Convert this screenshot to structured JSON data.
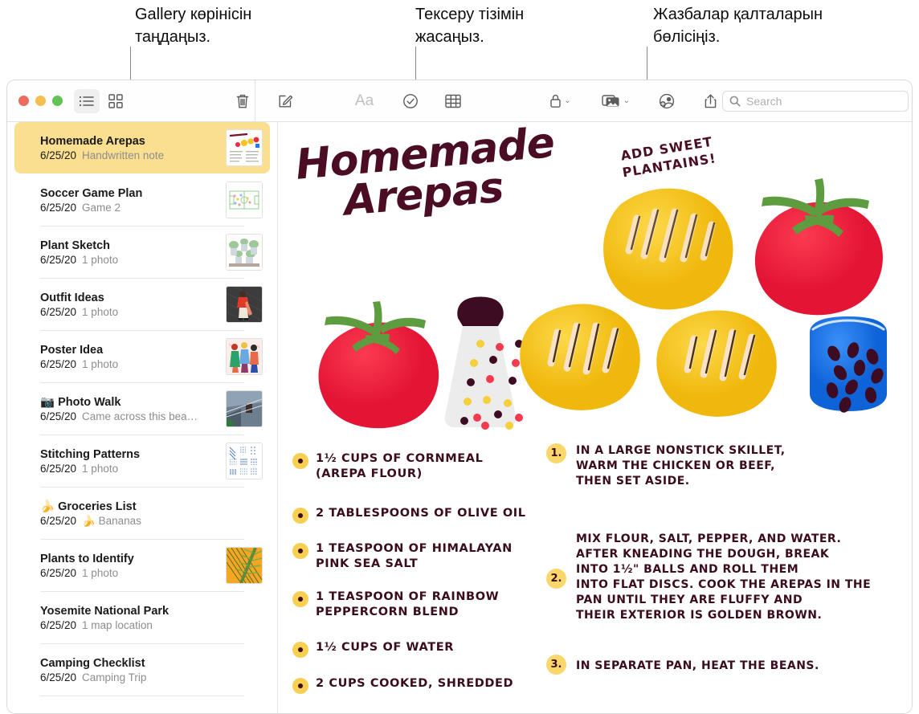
{
  "callouts": [
    {
      "text": "Gallery көрінісін\nтаңдаңыз.",
      "target": "gallery-view-button"
    },
    {
      "text": "Тексеру тізімін\nжасаңыз.",
      "target": "checklist-button"
    },
    {
      "text": "Жазбалар қалталарын\nбөлісіңіз.",
      "target": "share-folder-button"
    }
  ],
  "window": {
    "traffic_lights": [
      "close",
      "minimize",
      "zoom"
    ],
    "toolbar": {
      "list_view_label": "list-view",
      "gallery_view_label": "gallery-view",
      "delete_label": "delete-note",
      "compose_label": "new-note",
      "format_label": "Aa",
      "checklist_label": "checklist",
      "table_label": "table",
      "lock_label": "lock-note",
      "media_label": "insert-media",
      "share_folder_label": "share-folder",
      "share_label": "share-note",
      "chevron": "⌄"
    },
    "search": {
      "placeholder": "Search",
      "value": "",
      "icon": "search-icon"
    }
  },
  "sidebar": {
    "notes": [
      {
        "title": "Homemade Arepas",
        "date": "6/25/20",
        "snippet": "Handwritten note",
        "emoji": "",
        "selected": true,
        "thumb": "note-preview"
      },
      {
        "title": "Soccer Game Plan",
        "date": "6/25/20",
        "snippet": "Game 2",
        "emoji": "",
        "selected": false,
        "thumb": "soccer-field"
      },
      {
        "title": "Plant Sketch",
        "date": "6/25/20",
        "snippet": "1 photo",
        "emoji": "",
        "selected": false,
        "thumb": "plants"
      },
      {
        "title": "Outfit Ideas",
        "date": "6/25/20",
        "snippet": "1 photo",
        "emoji": "",
        "selected": false,
        "thumb": "outfit"
      },
      {
        "title": "Poster Idea",
        "date": "6/25/20",
        "snippet": "1 photo",
        "emoji": "",
        "selected": false,
        "thumb": "poster"
      },
      {
        "title": "Photo Walk",
        "date": "6/25/20",
        "snippet": "Came across this bea…",
        "emoji": "📷",
        "selected": false,
        "thumb": "photo-walk"
      },
      {
        "title": "Stitching Patterns",
        "date": "6/25/20",
        "snippet": "1 photo",
        "emoji": "",
        "selected": false,
        "thumb": "stitching"
      },
      {
        "title": "Groceries List",
        "date": "6/25/20",
        "snippet": "Bananas",
        "emoji": "🍌",
        "selected": false,
        "thumb": "none"
      },
      {
        "title": "Plants to Identify",
        "date": "6/25/20",
        "snippet": "1 photo",
        "emoji": "",
        "selected": false,
        "thumb": "palm"
      },
      {
        "title": "Yosemite National Park",
        "date": "6/25/20",
        "snippet": "1 map location",
        "emoji": "",
        "selected": false,
        "thumb": "none"
      },
      {
        "title": "Camping Checklist",
        "date": "6/25/20",
        "snippet": "Camping Trip",
        "emoji": "",
        "selected": false,
        "thumb": "none"
      }
    ]
  },
  "note": {
    "title_line1": "Homemade",
    "title_line2": "Arepas",
    "annotation_line1": "ADD SWEET",
    "annotation_line2": "PLANTAINS!",
    "ingredients": [
      "1½ CUPS OF CORNMEAL\n(AREPA FLOUR)",
      "2 TABLESPOONS OF OLIVE OIL",
      "1 TEASPOON OF HIMALAYAN\nPINK SEA SALT",
      "1 TEASPOON OF RAINBOW\nPEPPERCORN BLEND",
      "1½ CUPS OF WATER",
      "2 CUPS COOKED, SHREDDED"
    ],
    "steps": [
      {
        "num": "1.",
        "text": "IN A LARGE NONSTICK SKILLET,\nWARM THE CHICKEN OR BEEF,\nTHEN SET ASIDE."
      },
      {
        "num": "2.",
        "text": "MIX FLOUR, SALT, PEPPER, AND WATER.\nAFTER KNEADING THE DOUGH, BREAK\nINTO 1½\" BALLS AND ROLL THEM\nINTO FLAT DISCS. COOK THE AREPAS IN THE\nPAN UNTIL THEY ARE FLUFFY AND\nTHEIR EXTERIOR IS GOLDEN BROWN."
      },
      {
        "num": "3.",
        "text": "IN SEPARATE PAN, HEAT THE BEANS."
      }
    ],
    "colors": {
      "ink": "#3a0c1d",
      "title_ink": "#4a0d24",
      "arepa_yellow": "#f5c21e",
      "tomato_red": "#f02a3e",
      "leaf_green": "#5d9c3f",
      "bowl_blue": "#1e7bf0",
      "bullet_yellow": "#f7cf52",
      "selected_row": "#fadf91"
    }
  }
}
